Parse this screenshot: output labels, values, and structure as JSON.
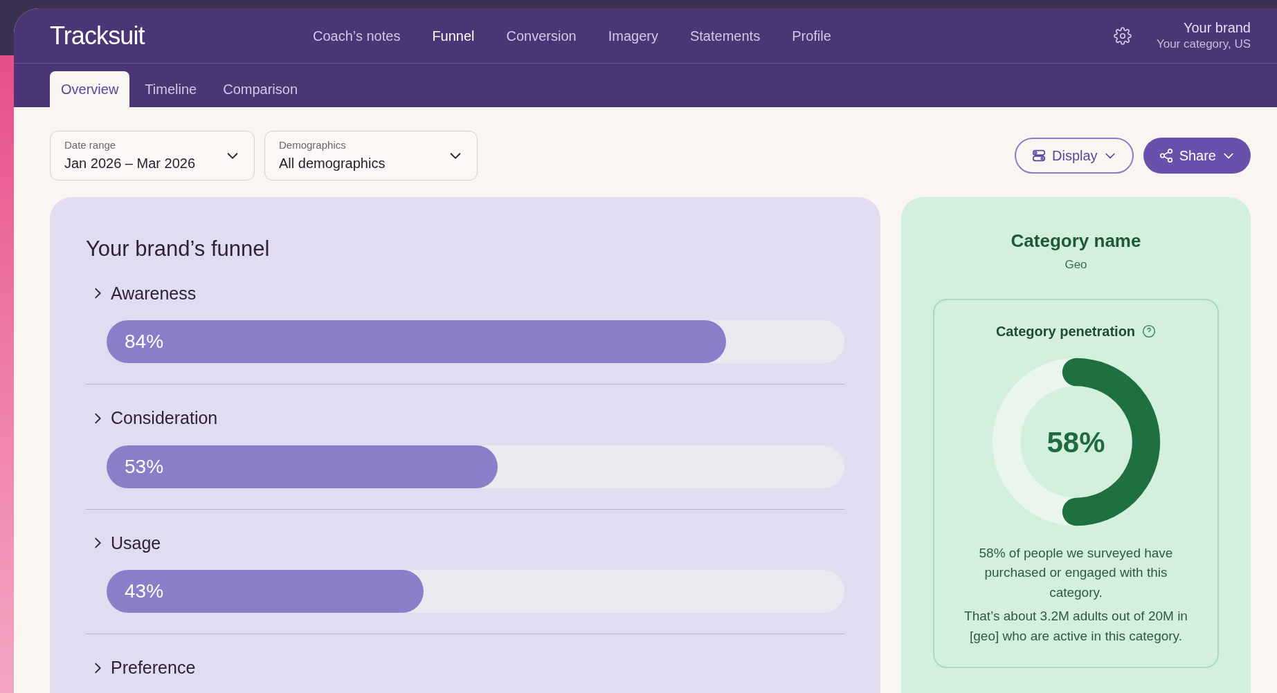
{
  "header": {
    "logo": "Tracksuit",
    "nav": [
      {
        "label": "Coach’s notes",
        "selected": false
      },
      {
        "label": "Funnel",
        "selected": true
      },
      {
        "label": "Conversion",
        "selected": false
      },
      {
        "label": "Imagery",
        "selected": false
      },
      {
        "label": "Statements",
        "selected": false
      },
      {
        "label": "Profile",
        "selected": false
      }
    ],
    "account": {
      "brand": "Your brand",
      "category": "Your category, US"
    }
  },
  "subtabs": [
    {
      "label": "Overview",
      "selected": true
    },
    {
      "label": "Timeline",
      "selected": false
    },
    {
      "label": "Comparison",
      "selected": false
    }
  ],
  "filters": [
    {
      "label": "Date range",
      "value": "Jan 2026 – Mar 2026"
    },
    {
      "label": "Demographics",
      "value": "All demographics"
    }
  ],
  "actions": {
    "display": "Display",
    "share": "Share"
  },
  "funnel": {
    "title": "Your brand’s funnel",
    "stages": [
      {
        "name": "Awareness",
        "expanded": false,
        "level": 0.84,
        "reading": "84%"
      },
      {
        "name": "Consideration",
        "expanded": false,
        "level": 0.53,
        "reading": "53%"
      },
      {
        "name": "Usage",
        "expanded": false,
        "level": 0.43,
        "reading": "43%"
      },
      {
        "name": "Preference",
        "expanded": false
      }
    ]
  },
  "category": {
    "title": "Category name",
    "subtitle": "Geo",
    "metric": {
      "title": "Category penetration",
      "level": 0.5,
      "reading": "58%",
      "description": "58% of people we surveyed have purchased or engaged with this category.",
      "detail": "That’s about 3.2M adults out of 20M in [geo] who are active in this category."
    }
  }
}
